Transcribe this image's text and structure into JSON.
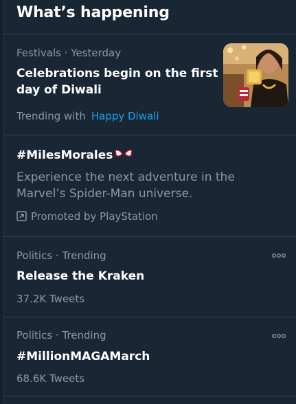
{
  "header": {
    "title": "What’s happening"
  },
  "trends": [
    {
      "meta": "Festivals · Yesterday",
      "title": "Celebrations begin on the first day of Diwali",
      "trending_prefix": "Trending with",
      "trending_link": "Happy Diwali",
      "thumbnail_icon": "diwali-photo"
    },
    {
      "title": "#MilesMorales",
      "emoji_icon": "spider-man-eyes-icon",
      "description": "Experience the next adventure in the Marvel’s Spider-Man universe.",
      "promoted": "Promoted by PlayStation",
      "promoted_icon": "promoted-arrow-icon"
    },
    {
      "meta": "Politics · Trending",
      "title": "Release the Kraken",
      "count": "37.2K Tweets",
      "more_icon": "more-options-icon"
    },
    {
      "meta": "Politics · Trending",
      "title": "#MillionMAGAMarch",
      "count": "68.6K Tweets",
      "more_icon": "more-options-icon"
    }
  ],
  "colors": {
    "background": "#192734",
    "text_primary": "#ffffff",
    "text_secondary": "#8899a6",
    "accent": "#1da1f2",
    "divider": "#38444d"
  }
}
